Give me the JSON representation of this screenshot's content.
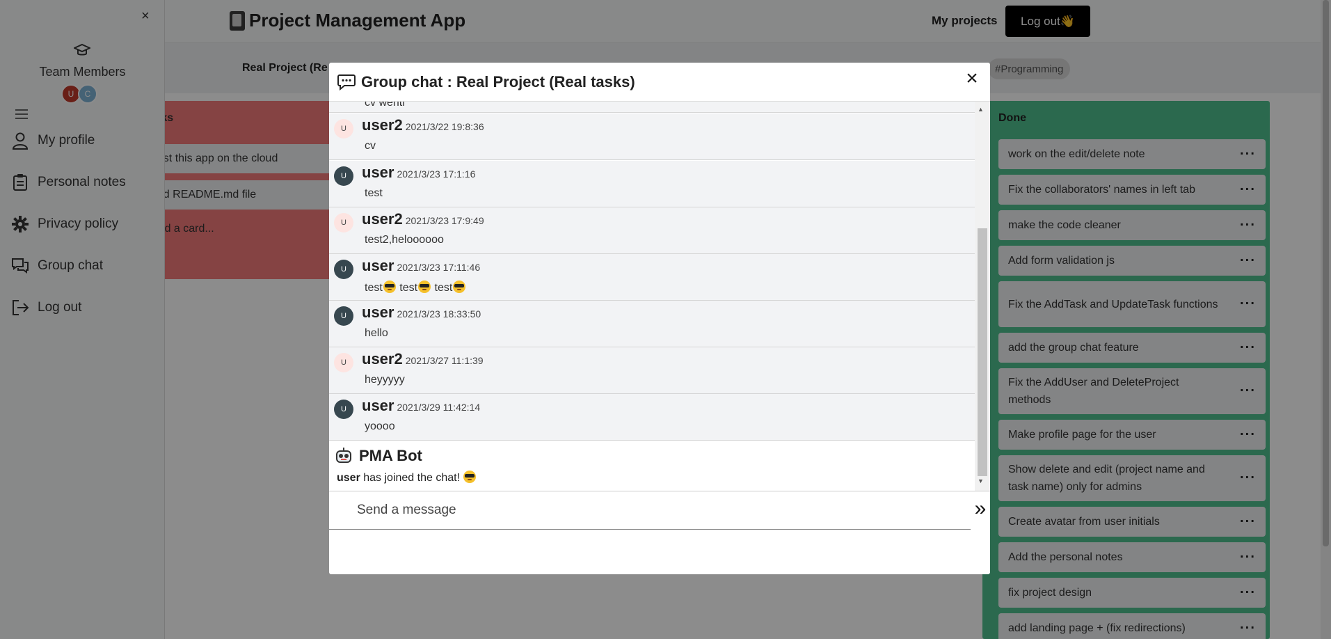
{
  "header": {
    "app_title": "Project Management App",
    "my_projects": "My projects",
    "logout_label": "Log out👋"
  },
  "project": {
    "name": "Real Project (Re",
    "tag": "#Programming"
  },
  "sidebar": {
    "close": "×",
    "team_label": "Team Members",
    "avatars": [
      "U",
      "C"
    ],
    "items": [
      {
        "label": "My profile",
        "icon": "user-icon"
      },
      {
        "label": "Personal notes",
        "icon": "clipboard-icon"
      },
      {
        "label": "Privacy policy",
        "icon": "gear-icon"
      },
      {
        "label": "Group chat",
        "icon": "chat-icon"
      },
      {
        "label": "Log out",
        "icon": "logout-icon"
      }
    ]
  },
  "todo_column": {
    "title": "Tasks",
    "cards": [
      "host this app on the cloud",
      "add README.md file"
    ],
    "add_card": "Add a card..."
  },
  "done_column": {
    "title": "Done",
    "cards": [
      "work on the edit/delete note",
      "Fix the collaborators' names in left tab",
      "make the code cleaner",
      "Add form validation js",
      "Fix the AddTask and UpdateTask functions",
      "add the group chat feature",
      "Fix the AddUser and DeleteProject methods",
      "Make profile page for the user",
      "Show delete and edit (project name and task name) only for admins",
      "Create avatar from user initials",
      "Add the personal notes",
      "fix project design",
      "add landing page + (fix redirections)"
    ]
  },
  "chat": {
    "title": "Group chat : Real Project (Real tasks)",
    "close": "×",
    "cut_off_text": "cv wenti",
    "messages": [
      {
        "user": "user2",
        "avatar": "U",
        "time": "2021/3/22 19:8:36",
        "text": "cv"
      },
      {
        "user": "user",
        "avatar": "U",
        "time": "2021/3/23 17:1:16",
        "text": "test"
      },
      {
        "user": "user2",
        "avatar": "U",
        "time": "2021/3/23 17:9:49",
        "text": "test2,heloooooo"
      },
      {
        "user": "user",
        "avatar": "U",
        "time": "2021/3/23 17:11:46",
        "text": "test",
        "emoji_text": "test😎 test😎 test😎"
      },
      {
        "user": "user",
        "avatar": "U",
        "time": "2021/3/23 18:33:50",
        "text": "hello"
      },
      {
        "user": "user2",
        "avatar": "U",
        "time": "2021/3/27 11:1:39",
        "text": "heyyyyy"
      },
      {
        "user": "user",
        "avatar": "U",
        "time": "2021/3/29 11:42:14",
        "text": "yoooo"
      }
    ],
    "bot": {
      "name": "PMA Bot",
      "joined_user": "user",
      "joined_text": "has joined the chat!"
    },
    "input_placeholder": "Send a message",
    "send_icon": "»"
  }
}
